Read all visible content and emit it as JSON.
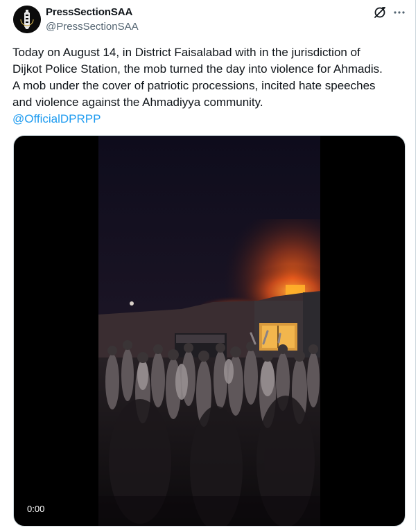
{
  "tweet": {
    "author": {
      "display_name": "PressSectionSAA",
      "handle": "@PressSectionSAA",
      "avatar_icon": "avatar-emblem-icon"
    },
    "text": "Today on August 14, in District Faisalabad with in the jurisdiction of\nDijkot Police Station, the mob turned the day into violence for Ahmadis.\nA mob under the cover of patriotic processions, incited hate speeches\nand violence against the Ahmadiyya community.",
    "mention": "@OfficialDPRPP",
    "actions": {
      "grok_icon": "grok-icon",
      "more_icon": "more-options-icon"
    },
    "video": {
      "timestamp": "0:00"
    }
  },
  "colors": {
    "text_primary": "#0f1419",
    "text_secondary": "#536471",
    "link": "#1d9bf0",
    "border": "#cfd9de"
  }
}
